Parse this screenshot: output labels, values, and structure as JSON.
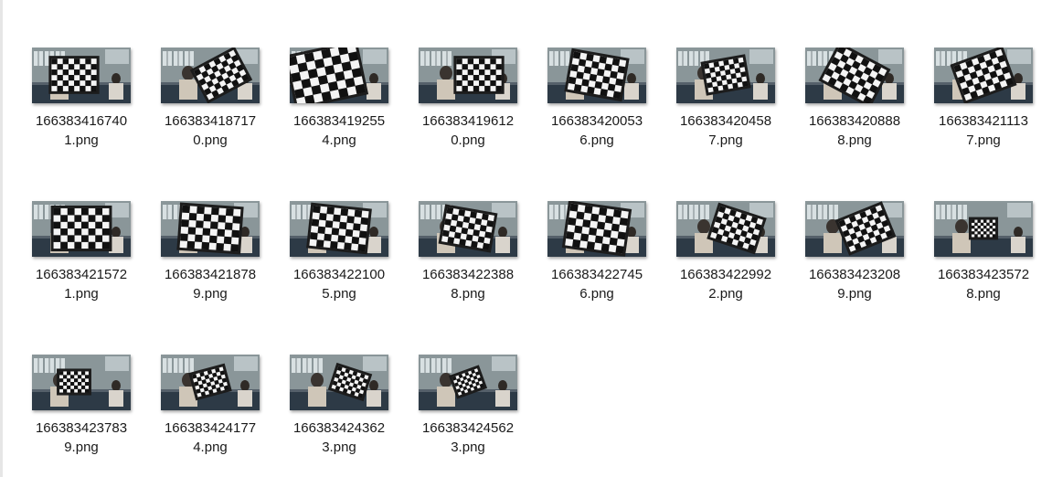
{
  "files": [
    {
      "name_line1": "166383416740",
      "name_line2": "1.png",
      "thumb": {
        "board_angle": 0,
        "board_side": "center-left",
        "board_scale": 0.85
      }
    },
    {
      "name_line1": "166383418717",
      "name_line2": "0.png",
      "thumb": {
        "board_angle": -28,
        "board_side": "right",
        "board_scale": 0.85
      }
    },
    {
      "name_line1": "166383419255",
      "name_line2": "4.png",
      "thumb": {
        "board_angle": -12,
        "board_side": "left",
        "board_scale": 1.3
      }
    },
    {
      "name_line1": "166383419612",
      "name_line2": "0.png",
      "thumb": {
        "board_angle": 0,
        "board_side": "right",
        "board_scale": 0.85
      }
    },
    {
      "name_line1": "166383420053",
      "name_line2": "6.png",
      "thumb": {
        "board_angle": 10,
        "board_side": "center",
        "board_scale": 1.0
      }
    },
    {
      "name_line1": "166383420458",
      "name_line2": "7.png",
      "thumb": {
        "board_angle": -10,
        "board_side": "center",
        "board_scale": 0.75
      }
    },
    {
      "name_line1": "166383420888",
      "name_line2": "8.png",
      "thumb": {
        "board_angle": 28,
        "board_side": "center",
        "board_scale": 1.0
      }
    },
    {
      "name_line1": "166383421113",
      "name_line2": "7.png",
      "thumb": {
        "board_angle": -20,
        "board_side": "center",
        "board_scale": 0.95
      }
    },
    {
      "name_line1": "166383421572",
      "name_line2": "1.png",
      "thumb": {
        "board_angle": 0,
        "board_side": "center",
        "board_scale": 1.05
      }
    },
    {
      "name_line1": "166383421878",
      "name_line2": "9.png",
      "thumb": {
        "board_angle": 4,
        "board_side": "center",
        "board_scale": 1.1
      }
    },
    {
      "name_line1": "166383422100",
      "name_line2": "5.png",
      "thumb": {
        "board_angle": 6,
        "board_side": "center",
        "board_scale": 1.05
      }
    },
    {
      "name_line1": "166383422388",
      "name_line2": "8.png",
      "thumb": {
        "board_angle": 10,
        "board_side": "center",
        "board_scale": 0.9
      }
    },
    {
      "name_line1": "166383422745",
      "name_line2": "6.png",
      "thumb": {
        "board_angle": 8,
        "board_side": "center",
        "board_scale": 1.1
      }
    },
    {
      "name_line1": "166383422992",
      "name_line2": "2.png",
      "thumb": {
        "board_angle": 18,
        "board_side": "right",
        "board_scale": 0.85
      }
    },
    {
      "name_line1": "166383423208",
      "name_line2": "9.png",
      "thumb": {
        "board_angle": -22,
        "board_side": "right",
        "board_scale": 0.85
      }
    },
    {
      "name_line1": "166383423572",
      "name_line2": "8.png",
      "thumb": {
        "board_angle": 0,
        "board_side": "center",
        "board_scale": 0.45
      }
    },
    {
      "name_line1": "166383423783",
      "name_line2": "9.png",
      "thumb": {
        "board_angle": 0,
        "board_side": "center-left",
        "board_scale": 0.55
      }
    },
    {
      "name_line1": "166383424177",
      "name_line2": "4.png",
      "thumb": {
        "board_angle": -15,
        "board_side": "center",
        "board_scale": 0.6
      }
    },
    {
      "name_line1": "166383424362",
      "name_line2": "3.png",
      "thumb": {
        "board_angle": 18,
        "board_side": "right",
        "board_scale": 0.6
      }
    },
    {
      "name_line1": "166383424562",
      "name_line2": "3.png",
      "thumb": {
        "board_angle": -20,
        "board_side": "center",
        "board_scale": 0.5
      }
    }
  ],
  "colors": {
    "background": "#ffffff",
    "text": "#1a1a1a",
    "scene_wall": "#8a9699",
    "scene_floor": "#2d3a46",
    "board_dark": "#111111",
    "board_light": "#f4f4f4",
    "frame": "#1c1c1c"
  }
}
